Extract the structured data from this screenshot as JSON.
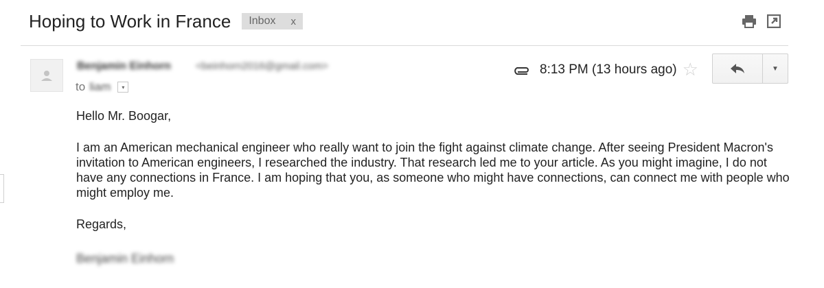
{
  "email": {
    "subject": "Hoping to Work in France",
    "label": {
      "name": "Inbox",
      "remove": "x"
    },
    "sender": {
      "name": "Benjamin Einhorn",
      "email": "<beinhorn2016@gmail.com>"
    },
    "to": {
      "prefix": "to",
      "name": "liam"
    },
    "time": "8:13 PM (13 hours ago)",
    "body": {
      "greeting": "Hello Mr. Boogar,",
      "paragraph": "I am an American mechanical engineer who really want to join the fight against climate change. After seeing President Macron's invitation to American engineers, I researched the industry. That research led me to your article. As you might imagine, I do not have any connections in France. I am hoping that you, as someone who might have connections, can connect me with people who might employ me.",
      "closing": "Regards,",
      "signature": "Benjamin Einhorn"
    }
  },
  "icons": {
    "print": "print-icon",
    "popout": "new-window-icon",
    "attachment": "paperclip-icon",
    "star": "star-icon",
    "reply": "reply-icon",
    "more": "chevron-down-icon",
    "avatar": "person-icon"
  },
  "colors": {
    "label_bg": "#dddddd",
    "divider": "#d9d9d9",
    "icon_gray": "#666666",
    "star_empty": "#d0d0d0"
  }
}
